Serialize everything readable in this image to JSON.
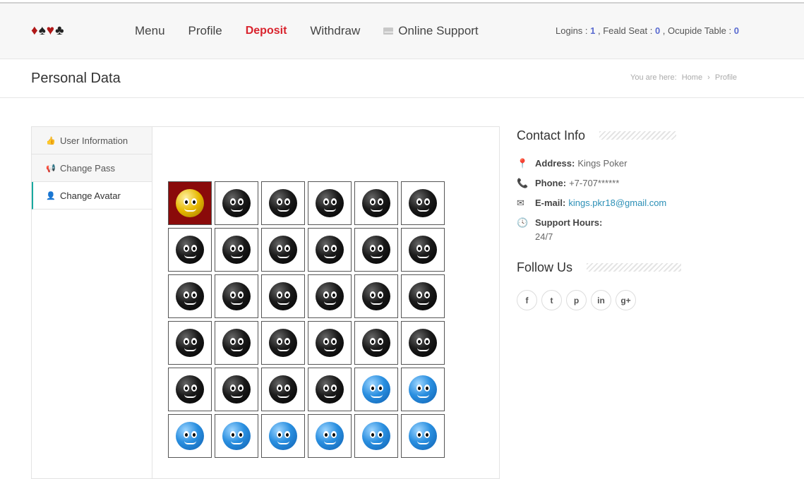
{
  "logo": {
    "suits": [
      "♦",
      "♠",
      "♥",
      "♣"
    ],
    "colors": [
      "#b01818",
      "#222222",
      "#b01818",
      "#222222"
    ]
  },
  "nav": {
    "items": [
      "Menu",
      "Profile",
      "Deposit",
      "Withdraw",
      "Online Support"
    ],
    "active": "Deposit"
  },
  "stats": {
    "logins_label": "Logins : ",
    "logins": "1",
    "seat_label": " , Feald Seat : ",
    "seat": "0",
    "table_label": " , Ocupide Table : ",
    "table": "0"
  },
  "page": {
    "title": "Personal Data"
  },
  "breadcrumb": {
    "prefix": "You are here:",
    "home": "Home",
    "sep": "›",
    "current": "Profile"
  },
  "tabs": [
    {
      "label": "User Information",
      "icon": "thumbs-up-icon"
    },
    {
      "label": "Change Pass",
      "icon": "bullhorn-icon"
    },
    {
      "label": "Change Avatar",
      "icon": "user-icon",
      "active": true
    }
  ],
  "avatars": {
    "columns": 6,
    "rows": 6,
    "selected_index": 0,
    "styles": [
      "gold",
      "black",
      "black",
      "black",
      "black",
      "black",
      "black",
      "black",
      "black",
      "black",
      "black",
      "black",
      "black",
      "black",
      "black",
      "black",
      "black",
      "black",
      "black",
      "black",
      "black",
      "black",
      "black",
      "black",
      "black",
      "black",
      "black",
      "black",
      "blue",
      "blue",
      "blue",
      "blue",
      "blue",
      "blue",
      "blue",
      "blue"
    ]
  },
  "contact": {
    "title": "Contact Info",
    "address_label": "Address:",
    "address": "Kings Poker",
    "phone_label": "Phone:",
    "phone": "+7-707******",
    "email_label": "E-mail:",
    "email": "kings.pkr18@gmail.com",
    "hours_label": "Support Hours:",
    "hours": "24/7"
  },
  "follow": {
    "title": "Follow Us",
    "networks": [
      "f",
      "t",
      "p",
      "in",
      "g+"
    ]
  },
  "accent": "#19a9a0",
  "brand_red": "#d9232d"
}
